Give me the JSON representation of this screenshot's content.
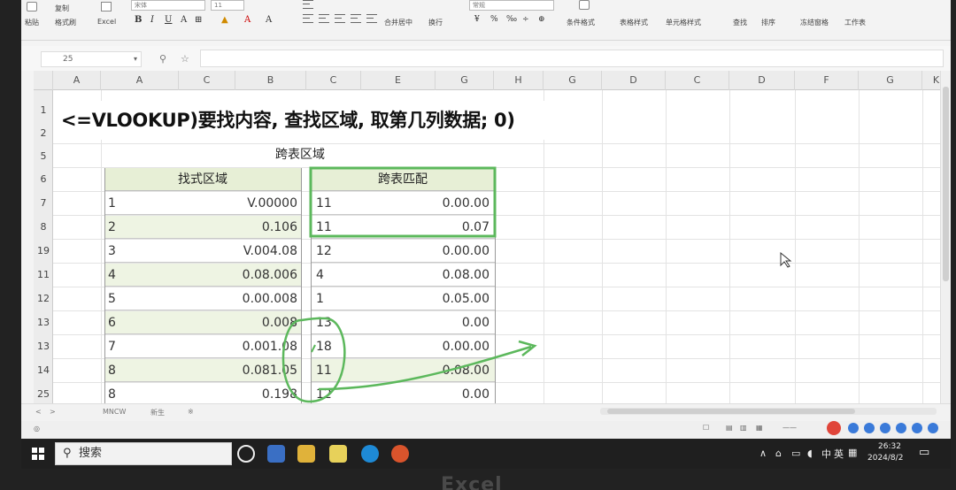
{
  "ribbon": {
    "paste_label": "粘贴",
    "copy_label": "复制",
    "format_label": "格式刷",
    "excel_label": "Excel",
    "font_name": "宋体",
    "font_size": "11",
    "fill_label": "填充",
    "wrap_label": "换行",
    "merge_label": "合并居中",
    "number_format": "常规",
    "conditional_label": "条件格式",
    "table_style_label": "表格样式",
    "cell_style_label": "单元格样式",
    "find_label": "查找",
    "sort_label": "排序",
    "freeze_label": "冻结窗格",
    "worksheet_label": "工作表"
  },
  "formula_bar": {
    "cell_ref": "25",
    "search_icon": "search-icon",
    "star_icon": "star-icon"
  },
  "columns": [
    "A",
    "A",
    "C",
    "B",
    "C",
    "E",
    "G",
    "H",
    "G",
    "D",
    "C",
    "D",
    "F",
    "G",
    "K"
  ],
  "rows": [
    "1",
    "2",
    "5",
    "6",
    "7",
    "8",
    "19",
    "11",
    "12",
    "13",
    "13",
    "14",
    "25"
  ],
  "formula_note": "<=VLOOKUP)要找内容, 查找区域, 取第几列数据; 0)",
  "table": {
    "title": "跨表区域",
    "left_header": "找式区域",
    "right_header": "跨表匹配",
    "left_rows": [
      {
        "a": "1",
        "b": "V.00000"
      },
      {
        "a": "2",
        "b": "0.106"
      },
      {
        "a": "3",
        "b": "V.004.08"
      },
      {
        "a": "4",
        "b": "0.08.006"
      },
      {
        "a": "5",
        "b": "0.00.008"
      },
      {
        "a": "6",
        "b": "0.008"
      },
      {
        "a": "7",
        "b": "0.001.08"
      },
      {
        "a": "8",
        "b": "0.081.05"
      },
      {
        "a": "8",
        "b": "0.198"
      }
    ],
    "right_rows": [
      {
        "c": "11",
        "d": "0.00.00"
      },
      {
        "c": "11",
        "d": "0.07"
      },
      {
        "c": "12",
        "d": "0.00.00"
      },
      {
        "c": "4",
        "d": "0.08.00"
      },
      {
        "c": "1",
        "d": "0.05.00"
      },
      {
        "c": "13",
        "d": "0.00"
      },
      {
        "c": "18",
        "d": "0.00.00"
      },
      {
        "c": "11",
        "d": "0.08.00"
      },
      {
        "c": "12",
        "d": "0.00"
      }
    ]
  },
  "sheets": [
    "MNCW",
    "新生",
    "※"
  ],
  "taskbar": {
    "search_text": "搜索",
    "ime": "中",
    "ime2": "英",
    "time": "26:32",
    "date": "2024/8/2"
  },
  "bezel_text": "Excel",
  "colors": {
    "highlight_green": "#5cb85c",
    "header_fill": "#e7efd6",
    "shade_fill": "#eef4e3"
  }
}
